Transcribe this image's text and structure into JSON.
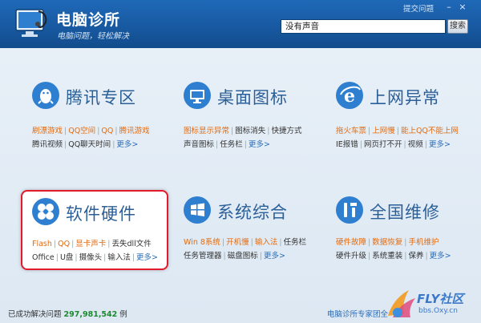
{
  "header": {
    "app_name": "电脑诊所",
    "slogan": "电脑问题，轻松解决",
    "feedback": "提交问题",
    "search_value": "没有声音",
    "search_button": "搜索"
  },
  "colors": {
    "accent": "#1a5ea8",
    "highlight_border": "#e11b2c",
    "link_orange": "#e36b10",
    "link_blue": "#2a6db7"
  },
  "tiles": [
    {
      "title": "腾讯专区",
      "icon": "penguin-icon",
      "row1": [
        "刷漂游戏",
        "QQ空间",
        "QQ",
        "腾讯游戏"
      ],
      "row2": [
        "腾讯视频",
        "QQ聊天时间"
      ],
      "more": "更多>"
    },
    {
      "title": "桌面图标",
      "icon": "monitor-icon",
      "row1": [
        "图标显示异常",
        "图标消失",
        "快捷方式"
      ],
      "row2": [
        "声音图标",
        "任务栏"
      ],
      "more": "更多>"
    },
    {
      "title": "上网异常",
      "icon": "ie-icon",
      "row1": [
        "拖火车票",
        "上网慢",
        "能上QQ不能上网"
      ],
      "row2": [
        "IE报错",
        "网页打不开",
        "视频"
      ],
      "more": "更多>"
    },
    {
      "title": "软件硬件",
      "icon": "windmill-icon",
      "row1": [
        "Flash",
        "QQ",
        "显卡声卡",
        "丢失dll文件"
      ],
      "row2": [
        "Office",
        "U盘",
        "摄像头",
        "输入法"
      ],
      "more": "更多>"
    },
    {
      "title": "系统综合",
      "icon": "windows-icon",
      "row1": [
        "Win 8系统",
        "开机慢",
        "输入法",
        "任务栏"
      ],
      "row2": [
        "任务管理器",
        "磁盘图标"
      ],
      "more": "更多>"
    },
    {
      "title": "全国维修",
      "icon": "tools-icon",
      "row1": [
        "硬件故障",
        "数据恢复",
        "手机维护"
      ],
      "row2": [
        "硬件升级",
        "系统重装",
        "保养"
      ],
      "more": "更多>"
    }
  ],
  "status": {
    "prefix": "已成功解决问题",
    "count": "297,981,542",
    "suffix": "例",
    "team": "电脑诊所专家团全"
  },
  "watermark": {
    "title": "FLY社区",
    "url": "bbs.Oxy.cn"
  }
}
